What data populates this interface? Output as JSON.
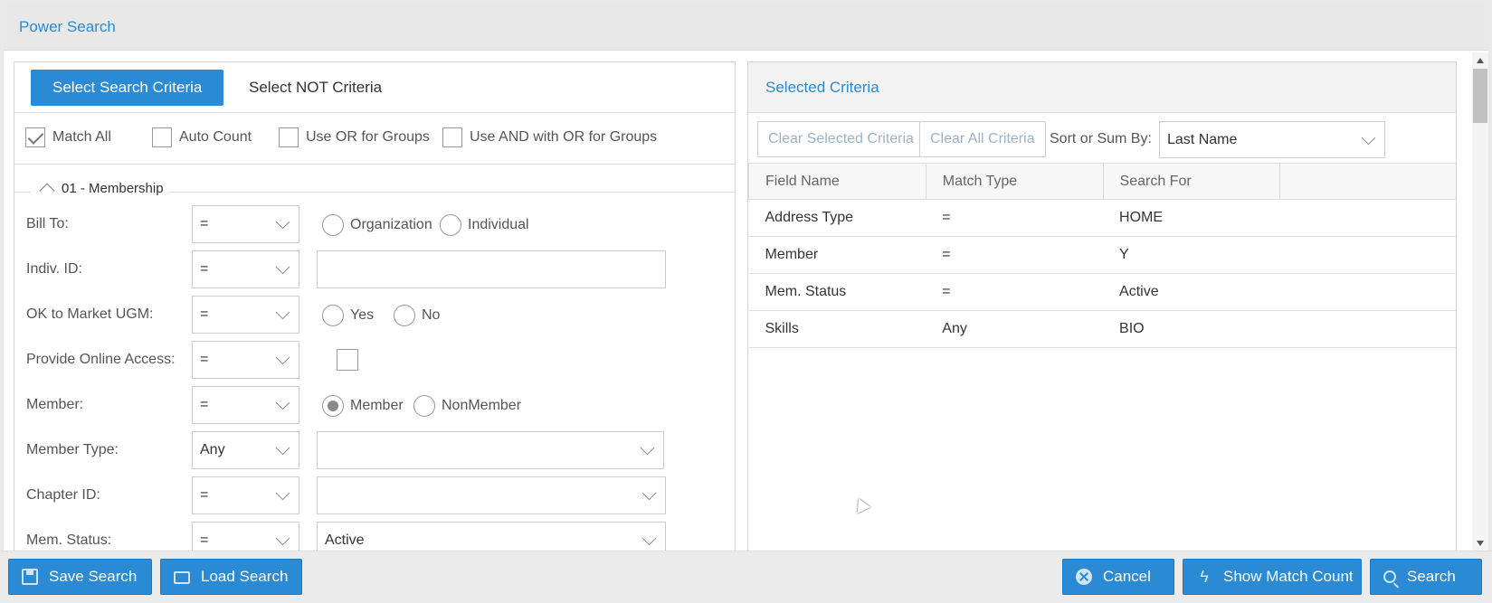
{
  "dialog": {
    "title": "Power Search"
  },
  "left": {
    "tabs": [
      {
        "label": "Select Search Criteria",
        "active": true
      },
      {
        "label": "Select NOT Criteria",
        "active": false
      }
    ],
    "options": [
      {
        "label": "Match All",
        "checked": true
      },
      {
        "label": "Auto Count",
        "checked": false
      },
      {
        "label": "Use OR for Groups",
        "checked": false
      },
      {
        "label": "Use AND with OR for Groups",
        "checked": false
      }
    ],
    "group": {
      "title": "01 - Membership"
    },
    "fields": [
      {
        "label": "Bill To:",
        "operator": "=",
        "radios": [
          {
            "label": "Organization",
            "checked": false
          },
          {
            "label": "Individual",
            "checked": false
          }
        ]
      },
      {
        "label": "Indiv. ID:",
        "operator": "=",
        "value": ""
      },
      {
        "label": "OK to Market UGM:",
        "operator": "=",
        "radios": [
          {
            "label": "Yes",
            "checked": false
          },
          {
            "label": "No",
            "checked": false
          }
        ]
      },
      {
        "label": "Provide Online Access:",
        "operator": "=",
        "checkbox": false
      },
      {
        "label": "Member:",
        "operator": "=",
        "radios": [
          {
            "label": "Member",
            "checked": true
          },
          {
            "label": "NonMember",
            "checked": false
          }
        ]
      },
      {
        "label": "Member Type:",
        "operator": "Any",
        "select_value": ""
      },
      {
        "label": "Chapter ID:",
        "operator": "=",
        "select_value": ""
      },
      {
        "label": "Mem. Status:",
        "operator": "=",
        "select_value": "Active"
      }
    ]
  },
  "right": {
    "title": "Selected Criteria",
    "toolbar": {
      "clear_selected": "Clear Selected Criteria",
      "clear_all": "Clear All Criteria",
      "sort_label": "Sort or Sum By:",
      "sort_value": "Last Name"
    },
    "table": {
      "columns": [
        "Field Name",
        "Match Type",
        "Search For",
        ""
      ],
      "rows": [
        [
          "Address Type",
          "=",
          "HOME"
        ],
        [
          "Member",
          "=",
          "Y"
        ],
        [
          "Mem. Status",
          "=",
          "Active"
        ],
        [
          "Skills",
          "Any",
          "BIO"
        ]
      ]
    }
  },
  "footer": {
    "save": "Save Search",
    "load": "Load Search",
    "cancel": "Cancel",
    "count": "Show Match Count",
    "search": "Search"
  },
  "colors": {
    "accent": "#2a8ad4"
  }
}
